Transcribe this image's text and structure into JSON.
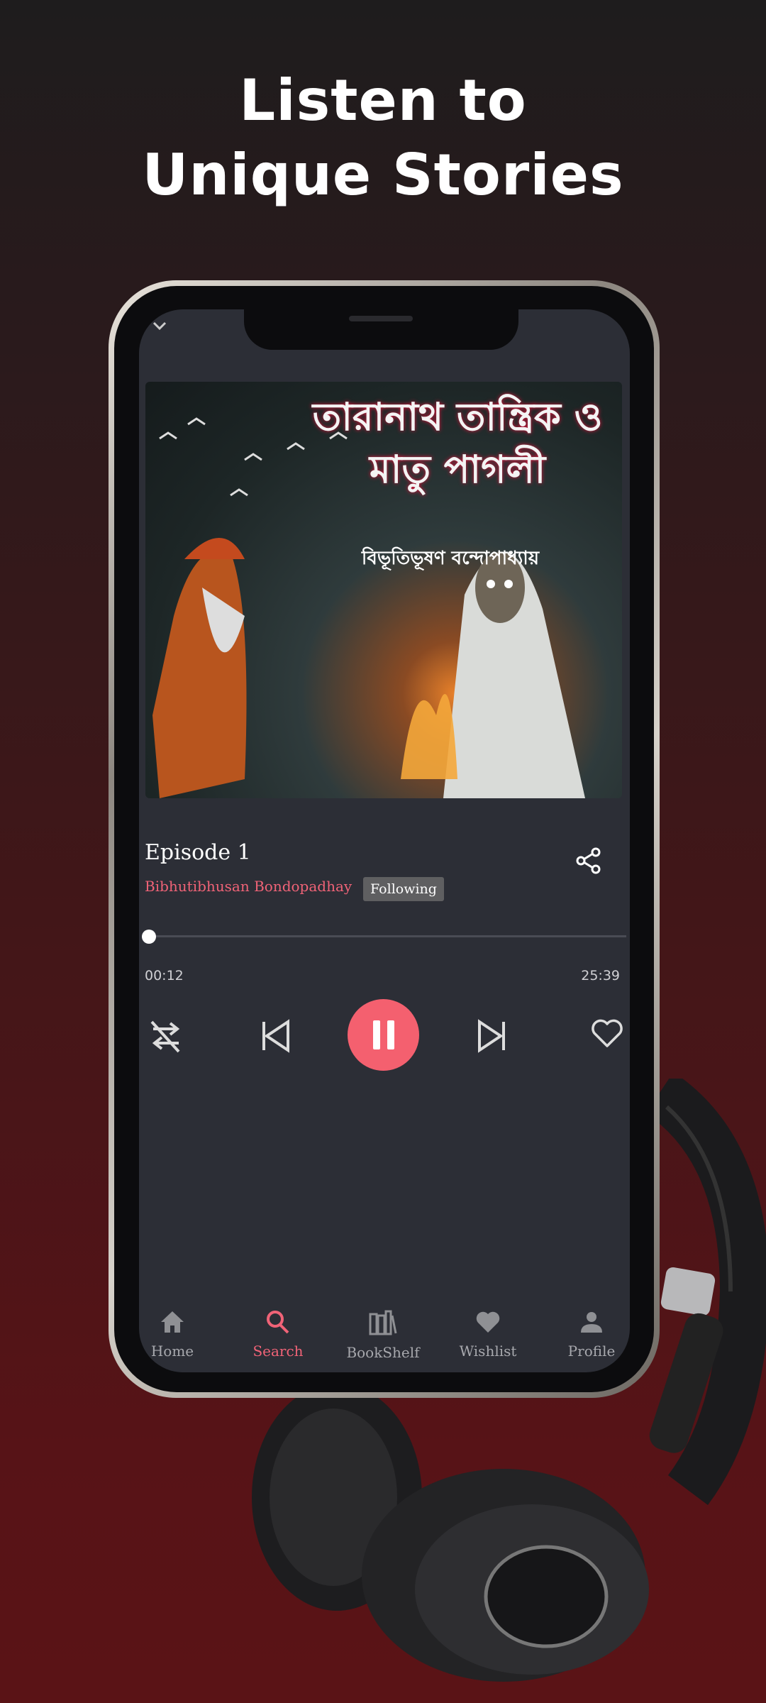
{
  "promo": {
    "line1": "Listen to",
    "line2": "Unique Stories"
  },
  "cover": {
    "title_art": "তারানাথ তান্ত্রিক ও মাতু পাগলী",
    "author_art": "বিভূতিভূষণ বন্দোপাধ্যায়"
  },
  "player": {
    "title": "Episode 1",
    "author": "Bibhutibhusan Bondopadhay",
    "follow_label": "Following",
    "elapsed": "00:12",
    "duration": "25:39",
    "progress_fraction": 0.008,
    "accent": "#f4606f"
  },
  "nav": {
    "items": [
      {
        "label": "Home",
        "icon": "home-icon"
      },
      {
        "label": "Search",
        "icon": "search-icon",
        "active": true
      },
      {
        "label": "BookShelf",
        "icon": "bookshelf-icon"
      },
      {
        "label": "Wishlist",
        "icon": "heart-icon"
      },
      {
        "label": "Profile",
        "icon": "profile-icon"
      }
    ]
  }
}
